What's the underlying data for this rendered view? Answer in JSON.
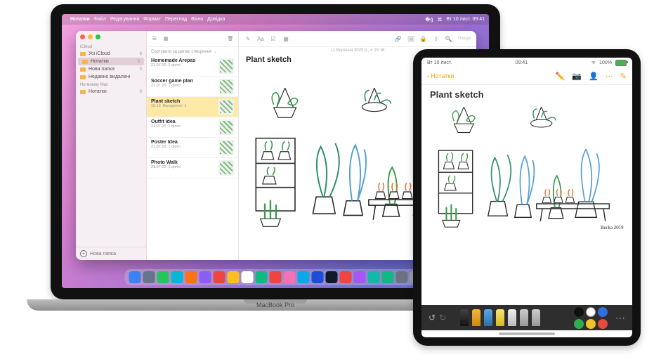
{
  "mac": {
    "menubar": {
      "app": "Нотатки",
      "items": [
        "Файл",
        "Редагування",
        "Формат",
        "Перегляд",
        "Вікно",
        "Довідка"
      ],
      "clock": "Вт 10 лист. 09:41"
    },
    "dock_colors": [
      "#3b82f6",
      "#64748b",
      "#22c55e",
      "#06b6d4",
      "#f97316",
      "#8b5cf6",
      "#ef4444",
      "#fbbf24",
      "#ffffff",
      "#10b981",
      "#ef4444",
      "#f472b6",
      "#0ea5e9",
      "#1d4ed8",
      "#111827",
      "#ef4444",
      "#a855f7",
      "#14b8a6",
      "#10b981",
      "#6b7280",
      "#9ca3af"
    ],
    "label": "MacBook Pro"
  },
  "notes": {
    "sidebar": {
      "section1": "iCloud",
      "items1": [
        {
          "label": "Усі iCloud",
          "count": "6"
        },
        {
          "label": "Нотатки",
          "count": "6",
          "selected": true
        },
        {
          "label": "Нова папка",
          "count": "0"
        },
        {
          "label": "Недавно видалені",
          "count": ""
        }
      ],
      "section2": "На моєму Mac",
      "items2": [
        {
          "label": "Нотатки",
          "count": "0"
        }
      ],
      "footer": "Нова папка"
    },
    "list": {
      "sort_label": "Сортувати за датою створення",
      "rows": [
        {
          "title": "Homemade Arepas",
          "date": "21.07.20",
          "sub": "1 фото"
        },
        {
          "title": "Soccer game plan",
          "date": "21.07.20",
          "sub": "1 фото"
        },
        {
          "title": "Plant sketch",
          "date": "15:18",
          "sub": "Вкладення: 1",
          "selected": true
        },
        {
          "title": "Outfit Idea",
          "date": "21.07.20",
          "sub": "1 фото"
        },
        {
          "title": "Poster Idea",
          "date": "21.07.20",
          "sub": "1 фото"
        },
        {
          "title": "Photo Walk",
          "date": "21.07.20",
          "sub": "1 фото"
        }
      ]
    },
    "editor": {
      "timestamp": "11 Вересня 2020 р., о 15:18",
      "title": "Plant sketch",
      "search_placeholder": "Пошук"
    }
  },
  "ipad": {
    "status": {
      "time": "Вт 10 лист.",
      "clock": "09:41",
      "battery": "100%"
    },
    "back_label": "Нотатки",
    "title": "Plant sketch",
    "palette": [
      "#111111",
      "#ffffff",
      "#2f6fe0",
      "#2fae4b",
      "#f3c22b",
      "#e64b3c"
    ]
  }
}
